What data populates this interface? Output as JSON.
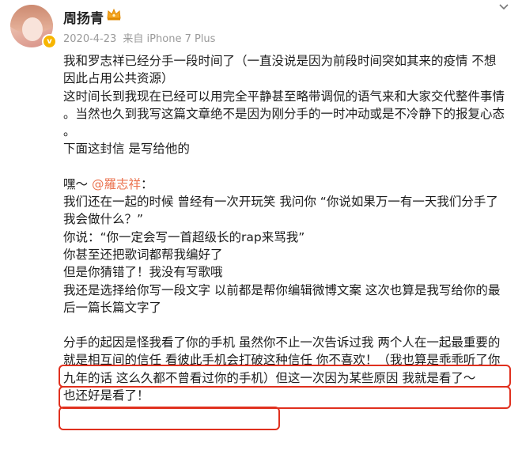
{
  "post": {
    "author": "周扬青",
    "date": "2020-4-23",
    "source": "来自 iPhone 7 Plus"
  },
  "content": {
    "lines_top": [
      "我和罗志祥已经分手一段时间了（一直没说是因为前段时间突如其来的疫情 不想",
      "因此占用公共资源）",
      "这时间长到我现在已经可以用完全平静甚至略带调侃的语气来和大家交代整件事情",
      "。当然也久到我写这篇文章绝不是因为刚分手的一时冲动或是不冷静下的报复心态",
      "。",
      "下面这封信 是写给他的"
    ],
    "greeting_prefix": "嘿～",
    "mention": "@羅志祥",
    "greeting_suffix": "：",
    "lines_letter": [
      "我们还在一起的时候 曾经有一次开玩笑 我问你 “你说如果万一有一天我们分手了",
      "我会做什么？”",
      "你说：“你一定会写一首超级长的rap来骂我”",
      "你甚至还把歌词都帮我编好了",
      "但是你猜错了！我没有写歌哦",
      "我还是选择给你写一段文字 以前都是帮你编辑微博文案 这次也算是我写给你的最",
      "后一篇长篇文字了"
    ],
    "lines_highlight": [
      "分手的起因是怪我看了你的手机 虽然你不止一次告诉过我 两个人在一起最重要的",
      "就是相互间的信任 看彼此手机会打破这种信任 你不喜欢！（我也算是乖乖听了你",
      "九年的话 这么久都不曾看过你的手机）但这一次因为某些原因 我就是看了～",
      "也还好是看了！"
    ]
  },
  "colors": {
    "highlight_border": "#e0301e",
    "mention": "#eb7350",
    "meta_gray": "#9a9a9a"
  },
  "icons": [
    "crown-icon",
    "verified-badge-icon",
    "chevron-down-icon"
  ]
}
